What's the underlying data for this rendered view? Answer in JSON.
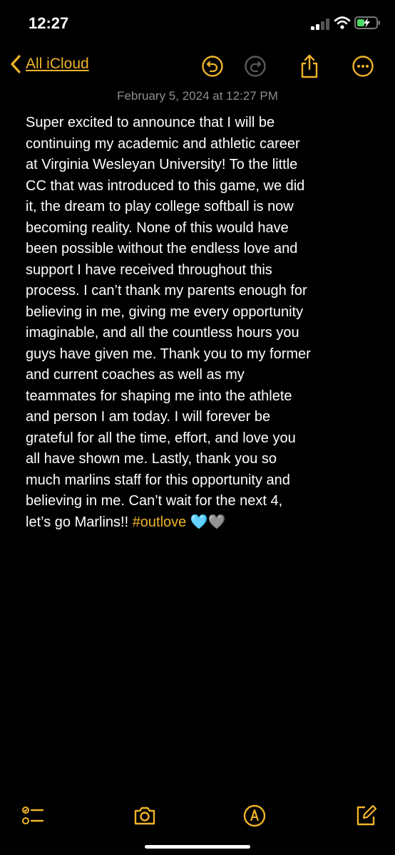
{
  "status": {
    "time": "12:27"
  },
  "nav": {
    "back_label": "All iCloud",
    "undo_icon": "undo-icon",
    "redo_icon": "redo-icon",
    "share_icon": "share-icon",
    "more_icon": "ellipsis-circle-icon"
  },
  "note": {
    "date": "February 5, 2024 at 12:27 PM",
    "body": "Super excited to announce that I will be\ncontinuing my academic and athletic career\nat Virginia Wesleyan University! To the little\nCC that was introduced to this game, we did\nit, the dream to play college softball is now\nbecoming reality. None of this would have\nbeen possible without the endless love and\nsupport I have received throughout this\nprocess. I can’t thank my parents enough for\nbelieving in me, giving me every opportunity\nimaginable, and all the countless hours you\nguys have given me. Thank you to my former\nand current coaches as well as my\nteammates for shaping me into the athlete\nand person I am today. I will forever be\ngrateful for all the time, effort, and love you\nall have shown me. Lastly, thank you so\nmuch marlins staff for this opportunity and\nbelieving in me. Can’t wait for the next 4,\nlet’s go Marlins!! ",
    "hashtag": "#outlove",
    "emoji": " 🩵🩶"
  },
  "toolbar": {
    "checklist_icon": "checklist-icon",
    "camera_icon": "camera-icon",
    "markup_icon": "markup-icon",
    "compose_icon": "compose-icon"
  },
  "colors": {
    "accent": "#f0b429",
    "background": "#000000",
    "date_gray": "#8e8e93"
  }
}
